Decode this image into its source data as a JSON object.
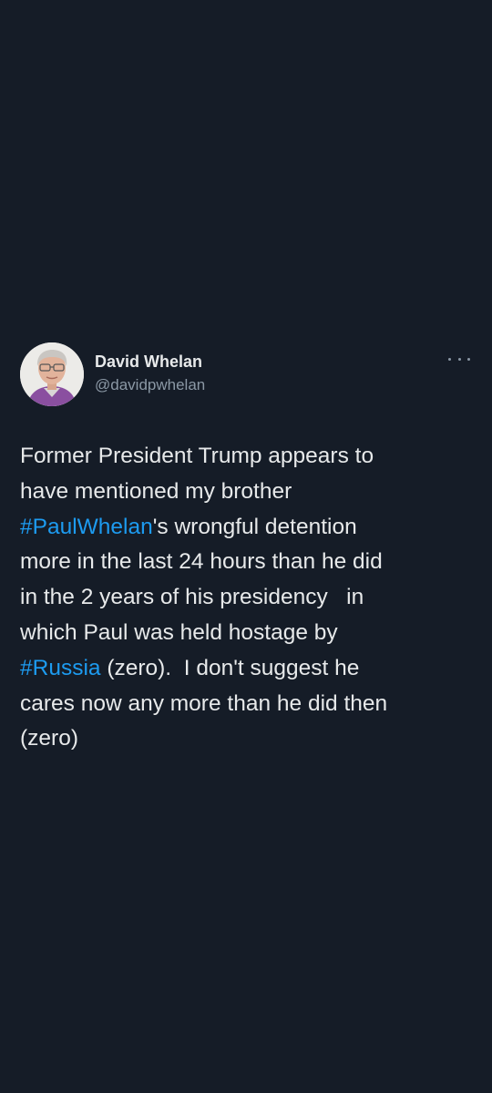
{
  "tweet": {
    "author": {
      "display_name": "David Whelan",
      "handle": "@davidpwhelan"
    },
    "more_icon": "more-horizontal-icon",
    "lines": [
      [
        {
          "t": "Former President Trump appears to"
        }
      ],
      [
        {
          "t": "have mentioned my brother"
        }
      ],
      [
        {
          "t": "#PaulWhelan",
          "tag": true
        },
        {
          "t": "'s wrongful detention"
        }
      ],
      [
        {
          "t": "more in the last 24 hours than he did"
        }
      ],
      [
        {
          "t": "in the 2 years of his presidency   in"
        }
      ],
      [
        {
          "t": "which Paul was held hostage by"
        }
      ],
      [
        {
          "t": "#Russia",
          "tag": true
        },
        {
          "t": " (zero).  I don't suggest he"
        }
      ],
      [
        {
          "t": "cares now any more than he did then"
        }
      ],
      [
        {
          "t": "(zero)"
        }
      ]
    ],
    "colors": {
      "background": "#151c27",
      "text": "#e7e9ea",
      "secondary_text": "#8b98a5",
      "hashtag": "#1d9bf0"
    }
  }
}
